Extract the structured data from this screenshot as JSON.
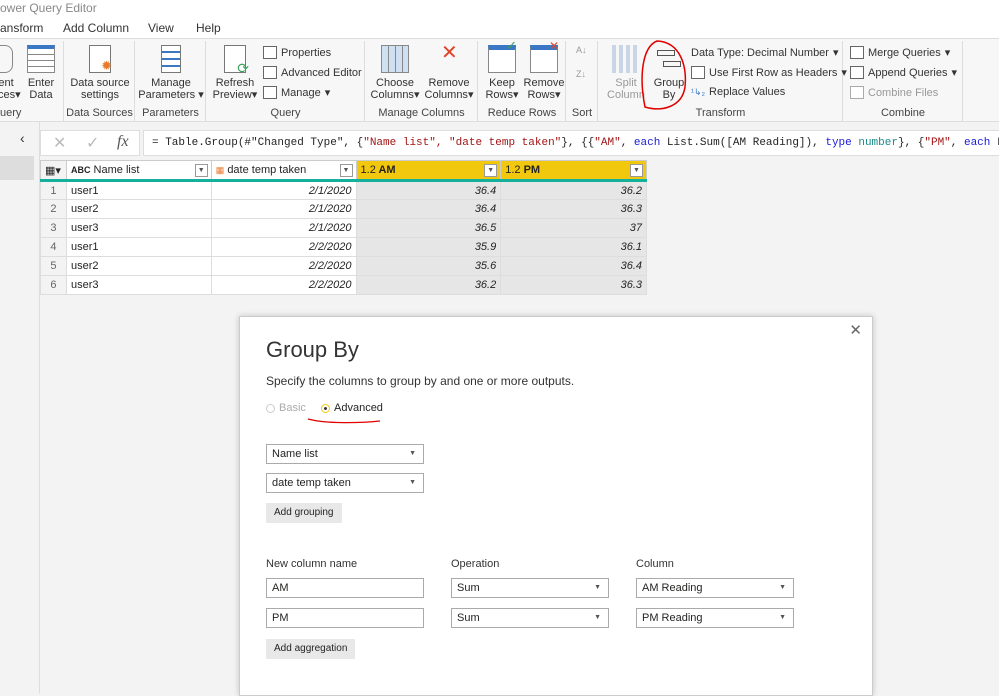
{
  "window": {
    "title": "ower Query Editor"
  },
  "menu": [
    "ansform",
    "Add Column",
    "View",
    "Help"
  ],
  "ribbon": {
    "partial": {
      "btn1": "ent",
      "btn1b": "ces",
      "enter_data": "Enter Data",
      "label": "uery"
    },
    "data_sources": {
      "btn": "Data source settings",
      "label": "Data Sources"
    },
    "parameters": {
      "btn": "Manage Parameters",
      "label": "Parameters"
    },
    "query": {
      "refresh": "Refresh Preview",
      "properties": "Properties",
      "advanced_editor": "Advanced Editor",
      "manage": "Manage",
      "label": "Query"
    },
    "manage_columns": {
      "choose": "Choose Columns",
      "remove": "Remove Columns",
      "label": "Manage Columns"
    },
    "reduce_rows": {
      "keep": "Keep Rows",
      "remove": "Remove Rows",
      "label": "Reduce Rows"
    },
    "sort": {
      "label": "Sort"
    },
    "transform": {
      "split": "Split Column",
      "group_by": "Group By",
      "data_type": "Data Type: Decimal Number",
      "first_row": "Use First Row as Headers",
      "replace": "Replace Values",
      "label": "Transform"
    },
    "combine": {
      "merge": "Merge Queries",
      "append": "Append Queries",
      "files": "Combine Files",
      "label": "Combine"
    }
  },
  "formula": {
    "p1": "= Table.Group(#\"Changed Type\", {",
    "p2": "\"Name list\", \"date temp taken\"",
    "p3": "}, {{",
    "p4": "\"AM\"",
    "p5": ", ",
    "p6": "each",
    "p7": " List.Sum([AM Reading]), ",
    "p8": "type",
    "p9": " ",
    "p10": "number",
    "p11": "}, {",
    "p12": "\"PM\"",
    "p13": ", ",
    "p14": "each",
    "p15": " List.Sum([PM R"
  },
  "table": {
    "headers": [
      {
        "type": "ABC",
        "name": "Name list"
      },
      {
        "type": "date",
        "name": "date temp taken"
      },
      {
        "type": "1.2",
        "name": "AM"
      },
      {
        "type": "1.2",
        "name": "PM"
      }
    ],
    "rows": [
      [
        "1",
        "user1",
        "2/1/2020",
        "36.4",
        "36.2"
      ],
      [
        "2",
        "user2",
        "2/1/2020",
        "36.4",
        "36.3"
      ],
      [
        "3",
        "user3",
        "2/1/2020",
        "36.5",
        "37"
      ],
      [
        "4",
        "user1",
        "2/2/2020",
        "35.9",
        "36.1"
      ],
      [
        "5",
        "user2",
        "2/2/2020",
        "35.6",
        "36.4"
      ],
      [
        "6",
        "user3",
        "2/2/2020",
        "36.2",
        "36.3"
      ]
    ]
  },
  "dialog": {
    "title": "Group By",
    "subtitle": "Specify the columns to group by and one or more outputs.",
    "basic": "Basic",
    "advanced": "Advanced",
    "mode": "Advanced",
    "groupings": [
      "Name list",
      "date temp taken"
    ],
    "add_grouping": "Add grouping",
    "col_new": "New column name",
    "col_op": "Operation",
    "col_col": "Column",
    "aggregations": [
      {
        "name": "AM",
        "op": "Sum",
        "column": "AM Reading"
      },
      {
        "name": "PM",
        "op": "Sum",
        "column": "PM Reading"
      }
    ],
    "add_aggregation": "Add aggregation"
  },
  "colors": {
    "accent": "#f2c80f",
    "teal": "#15b09c",
    "annotation": "#e00000"
  }
}
